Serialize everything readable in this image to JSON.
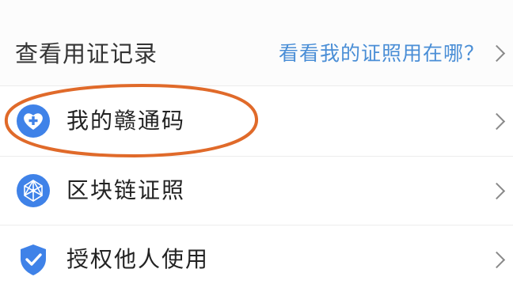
{
  "header": {
    "title": "查看用证记录",
    "link_label": "看看我的证照用在哪？"
  },
  "menu": {
    "items": [
      {
        "label": "我的赣通码",
        "icon": "health-code-icon"
      },
      {
        "label": "区块链证照",
        "icon": "blockchain-icon"
      },
      {
        "label": "授权他人使用",
        "icon": "shield-check-icon"
      }
    ]
  },
  "colors": {
    "link": "#4a8ed6",
    "icon_blue": "#3f82e8",
    "annotation": "#e06a2a"
  }
}
